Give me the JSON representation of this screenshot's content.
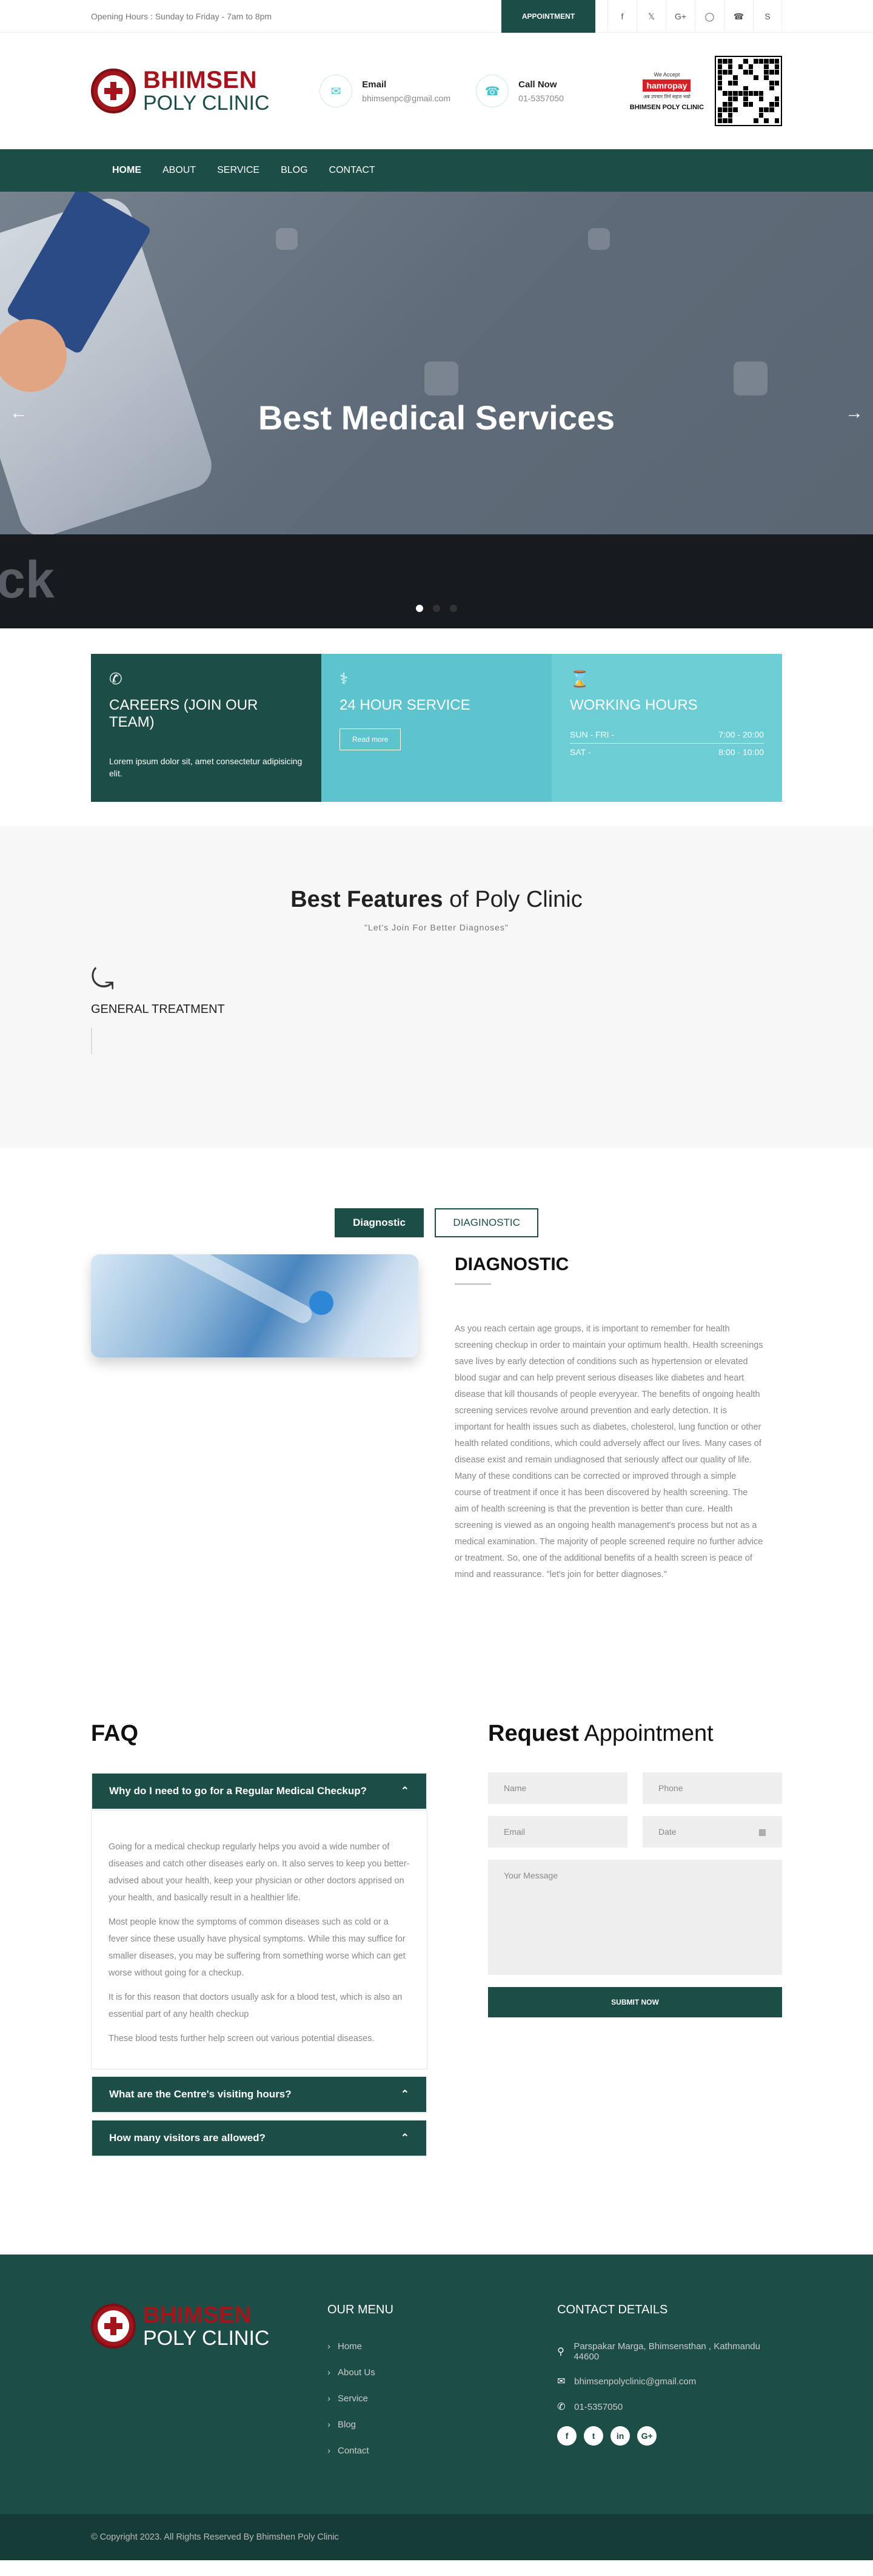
{
  "topbar": {
    "hours": "Opening Hours : Sunday to Friday - 7am to 8pm",
    "appointment": "APPOINTMENT",
    "social": [
      "facebook-icon",
      "twitter-icon",
      "google-plus-icon",
      "instagram-icon",
      "whatsapp-icon",
      "skype-icon"
    ]
  },
  "header": {
    "logo_line1": "BHIMSEN",
    "logo_line2": "POLY CLINIC",
    "email_label": "Email",
    "email_value": "bhimsenpc@gmail.com",
    "call_label": "Call Now",
    "call_value": "01-5357050",
    "partner_tag": "We Accept",
    "partner_brand": "hamropay",
    "partner_sub": "अब उपचार तिर्न सहज भयो",
    "partner_name": "BHIMSEN POLY CLINIC"
  },
  "nav": [
    "HOME",
    "ABOUT",
    "SERVICE",
    "BLOG",
    "CONTACT"
  ],
  "hero": {
    "title": "Best Medical Services",
    "prev": "←",
    "next": "→"
  },
  "info": {
    "careers_title": "CAREERS (JOIN OUR TEAM)",
    "careers_text": "Lorem ipsum dolor sit, amet consectetur adipisicing elit.",
    "service_title": "24 HOUR SERVICE",
    "service_button": "Read more",
    "hours_title": "WORKING HOURS",
    "hours_rows": [
      {
        "day": "SUN - FRI -",
        "time": "7:00 - 20:00"
      },
      {
        "day": "SAT -",
        "time": "8:00 - 10:00"
      }
    ]
  },
  "features": {
    "title_bold": "Best Features",
    "title_rest": " of Poly Clinic",
    "subtitle": "\"Let's Join For Better Diagnoses\"",
    "item": "GENERAL TREATMENT"
  },
  "diagnostic": {
    "tab1": "Diagnostic",
    "tab2": "DIAGINOSTIC",
    "heading": "DIAGNOSTIC",
    "text": "As you reach certain age groups, it is important to remember for health screening checkup in order to maintain your optimum health. Health screenings save lives by early detection of conditions such as hypertension or elevated blood sugar and can help prevent serious diseases like diabetes and heart disease that kill thousands of people everyyear. The benefits of ongoing health screening services revolve around prevention and early detection. It is important for health issues such as diabetes, cholesterol, lung function or other health related conditions, which could adversely affect our lives. Many cases of disease exist and remain undiagnosed that seriously affect our quality of life. Many of these conditions can be corrected or improved through a simple course of treatment if once it has been discovered by health screening. The aim of health screening is that the prevention is better than cure. Health screening is viewed as an ongoing health management's process but not as a medical examination. The majority of people screened require no further advice or treatment. So, one of the additional benefits of a health screen is peace of mind and reassurance. \"let's join for better diagnoses.\""
  },
  "faq": {
    "title": "FAQ",
    "q1": "Why do I need to go for a Regular Medical Checkup?",
    "a1": [
      "Going for a medical checkup regularly helps you avoid a wide number of diseases and catch other diseases early on. It also serves to keep you better-advised about your health, keep your physician or other doctors apprised on your health, and basically result in a healthier life.",
      "Most people know the symptoms of common diseases such as cold or a fever since these usually have physical symptoms. While this may suffice for smaller diseases, you may be suffering from something worse which can get worse without going for a checkup.",
      "It is for this reason that doctors usually ask for a blood test, which is also an essential part of any health checkup",
      "These blood tests further help screen out various potential diseases."
    ],
    "q2": "What are the Centre's visiting hours?",
    "q3": "How many visitors are allowed?"
  },
  "appointment": {
    "title_bold": "Request",
    "title_rest": " Appointment",
    "name": "Name",
    "phone": "Phone",
    "email": "Email",
    "date": "Date",
    "message": "Your Message",
    "submit": "SUBMIT NOW"
  },
  "footer": {
    "menu_title": "OUR MENU",
    "menu": [
      "Home",
      "About Us",
      "Service",
      "Blog",
      "Contact"
    ],
    "contact_title": "CONTACT DETAILS",
    "address": "Parspakar Marga, Bhimsensthan , Kathmandu 44600",
    "email": "bhimsenpolyclinic@gmail.com",
    "phone": "01-5357050",
    "copyright": "© Copyright 2023. All Rights Reserved By Bhimshen Poly Clinic"
  },
  "colors": {
    "primary": "#1c4d47",
    "accent": "#5dc3cd",
    "brand_red": "#a3151c"
  }
}
